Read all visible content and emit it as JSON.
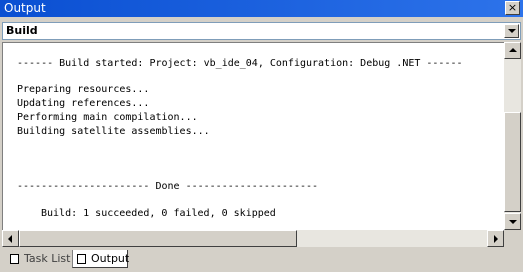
{
  "window": {
    "title": "Output",
    "close_symbol": "×"
  },
  "pane_selector": {
    "selected": "Build"
  },
  "output_lines": {
    "l1": "------ Build started: Project: vb_ide_04, Configuration: Debug .NET ------",
    "l2": "Preparing resources...",
    "l3": "Updating references...",
    "l4": "Performing main compilation...",
    "l5": "Building satellite assemblies...",
    "l6": "---------------------- Done ----------------------",
    "l7": "Build: 1 succeeded, 0 failed, 0 skipped"
  },
  "tabs": {
    "task_list": "Task List",
    "output": "Output"
  },
  "colors": {
    "titlebar": "#0a4fd2",
    "chrome": "#d4d0c8",
    "text_area": "#ffffff"
  }
}
